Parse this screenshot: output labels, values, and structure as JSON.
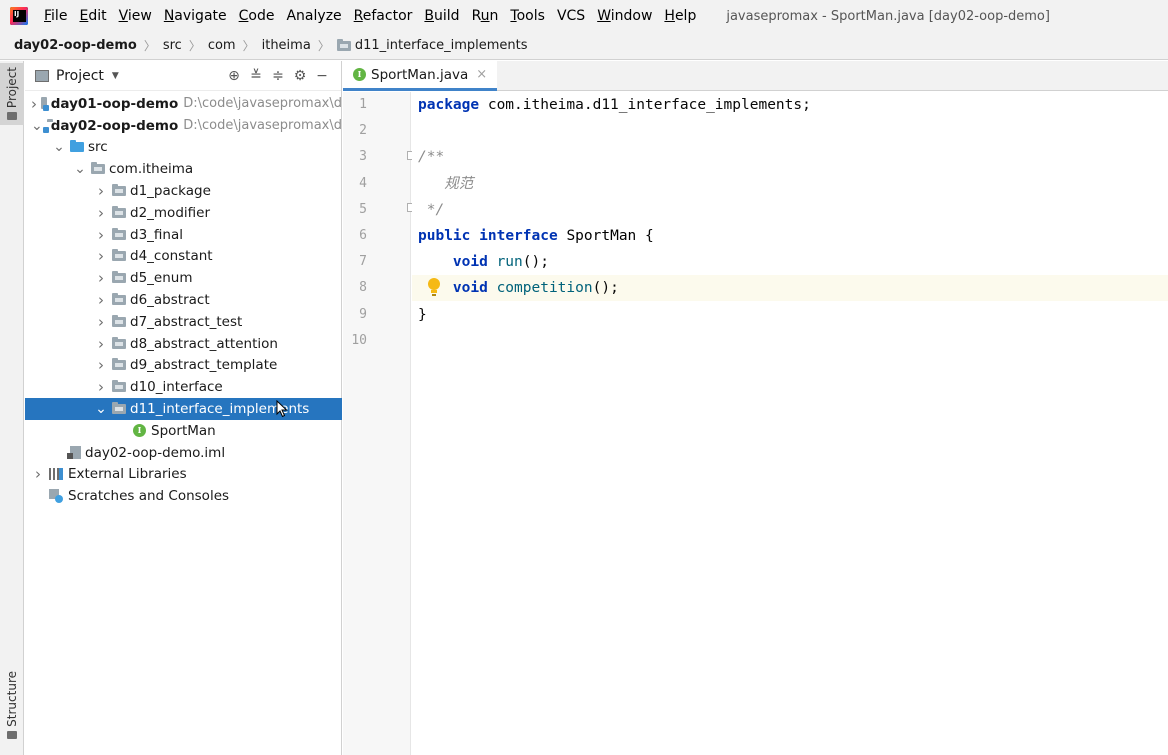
{
  "window": {
    "title": "javasepromax - SportMan.java [day02-oop-demo]"
  },
  "menu": [
    {
      "u": "F",
      "rest": "ile"
    },
    {
      "u": "E",
      "rest": "dit"
    },
    {
      "u": "V",
      "rest": "iew"
    },
    {
      "u": "N",
      "rest": "avigate"
    },
    {
      "u": "C",
      "rest": "ode"
    },
    {
      "u": "",
      "rest": "Analyze"
    },
    {
      "u": "R",
      "rest": "efactor"
    },
    {
      "u": "B",
      "rest": "uild"
    },
    {
      "u": "",
      "rest": "Run",
      "pre": "R",
      "post": "n",
      "mid": "u"
    },
    {
      "u": "T",
      "rest": "ools"
    },
    {
      "u": "",
      "rest": "VCS"
    },
    {
      "u": "W",
      "rest": "indow"
    },
    {
      "u": "H",
      "rest": "elp"
    }
  ],
  "breadcrumb": {
    "items": [
      "day02-oop-demo",
      "src",
      "com",
      "itheima",
      "d11_interface_implements"
    ]
  },
  "sidebar": {
    "project_tab": "Project",
    "structure_tab": "Structure"
  },
  "project_panel": {
    "title": "Project",
    "tree": [
      {
        "label": "day01-oop-demo",
        "hint": "D:\\code\\javasepromax\\d",
        "depth": 0,
        "chev": "right",
        "icon": "module",
        "bold": true
      },
      {
        "label": "day02-oop-demo",
        "hint": "D:\\code\\javasepromax\\d",
        "depth": 0,
        "chev": "down",
        "icon": "module",
        "bold": true
      },
      {
        "label": "src",
        "depth": 1,
        "chev": "down",
        "icon": "blue"
      },
      {
        "label": "com.itheima",
        "depth": 2,
        "chev": "down",
        "icon": "pkg"
      },
      {
        "label": "d1_package",
        "depth": 3,
        "chev": "right",
        "icon": "pkg"
      },
      {
        "label": "d2_modifier",
        "depth": 3,
        "chev": "right",
        "icon": "pkg"
      },
      {
        "label": "d3_final",
        "depth": 3,
        "chev": "right",
        "icon": "pkg"
      },
      {
        "label": "d4_constant",
        "depth": 3,
        "chev": "right",
        "icon": "pkg"
      },
      {
        "label": "d5_enum",
        "depth": 3,
        "chev": "right",
        "icon": "pkg"
      },
      {
        "label": "d6_abstract",
        "depth": 3,
        "chev": "right",
        "icon": "pkg"
      },
      {
        "label": "d7_abstract_test",
        "depth": 3,
        "chev": "right",
        "icon": "pkg"
      },
      {
        "label": "d8_abstract_attention",
        "depth": 3,
        "chev": "right",
        "icon": "pkg"
      },
      {
        "label": "d9_abstract_template",
        "depth": 3,
        "chev": "right",
        "icon": "pkg"
      },
      {
        "label": "d10_interface",
        "depth": 3,
        "chev": "right",
        "icon": "pkg"
      },
      {
        "label": "d11_interface_implements",
        "depth": 3,
        "chev": "down",
        "icon": "pkg",
        "selected": true
      },
      {
        "label": "SportMan",
        "depth": 4,
        "chev": "none",
        "icon": "interface"
      },
      {
        "label": "day02-oop-demo.iml",
        "depth": 1,
        "chev": "none",
        "icon": "iml"
      },
      {
        "label": "External Libraries",
        "depth": 0,
        "chev": "right",
        "icon": "lib"
      },
      {
        "label": "Scratches and Consoles",
        "depth": 0,
        "chev": "none",
        "icon": "scratch"
      }
    ]
  },
  "editor": {
    "tab_label": "SportMan.java",
    "line_numbers": [
      "1",
      "2",
      "3",
      "4",
      "5",
      "6",
      "7",
      "8",
      "9",
      "10"
    ],
    "current_line": 8,
    "lines": [
      [
        {
          "t": "package",
          "c": "kw"
        },
        {
          "t": " com.itheima.d11_interface_implements;",
          "c": "plain"
        }
      ],
      [],
      [
        {
          "t": "/**",
          "c": "cmt"
        }
      ],
      [
        {
          "t": "   规范",
          "c": "cmt"
        }
      ],
      [
        {
          "t": " */",
          "c": "cmt"
        }
      ],
      [
        {
          "t": "public",
          "c": "kw"
        },
        {
          "t": " ",
          "c": "plain"
        },
        {
          "t": "interface",
          "c": "kw"
        },
        {
          "t": " ",
          "c": "plain"
        },
        {
          "t": "SportMan",
          "c": "iface-name"
        },
        {
          "t": " {",
          "c": "plain"
        }
      ],
      [
        {
          "t": "    ",
          "c": "plain"
        },
        {
          "t": "void",
          "c": "kw"
        },
        {
          "t": " ",
          "c": "plain"
        },
        {
          "t": "run",
          "c": "method"
        },
        {
          "t": "();",
          "c": "plain"
        }
      ],
      [
        {
          "t": "    ",
          "c": "plain"
        },
        {
          "t": "void",
          "c": "kw"
        },
        {
          "t": " ",
          "c": "plain"
        },
        {
          "t": "competition",
          "c": "method"
        },
        {
          "t": "();",
          "c": "plain"
        }
      ],
      [
        {
          "t": "}",
          "c": "plain"
        }
      ],
      []
    ]
  },
  "colors": {
    "selection": "#2675bf",
    "keyword": "#0033b3",
    "method": "#00627a",
    "comment": "#8c8c8c",
    "current_line": "#fcfaed",
    "tab_underline": "#4083c9"
  }
}
